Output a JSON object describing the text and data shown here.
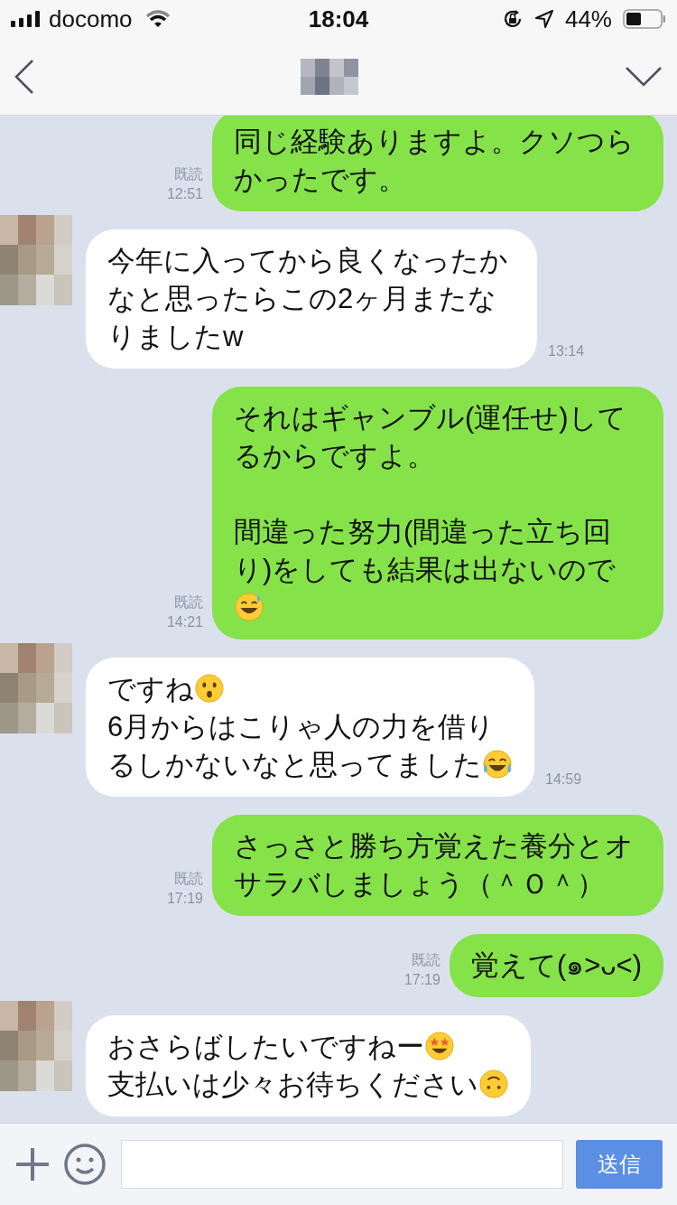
{
  "status_bar": {
    "carrier": "docomo",
    "time": "18:04",
    "battery": "44%"
  },
  "messages": [
    {
      "kind": "sent",
      "read_label": "既読",
      "time": "12:51",
      "paragraphs": [
        {
          "parts": [
            {
              "kind": "text",
              "text": "同じ経験ありますよ。クソつらかったです。"
            }
          ]
        }
      ]
    },
    {
      "kind": "received",
      "time": "13:14",
      "paragraphs": [
        {
          "parts": [
            {
              "kind": "text",
              "text": "今年に入ってから良くなったかなと思ったらこの2ヶ月またなりましたw"
            }
          ]
        }
      ]
    },
    {
      "kind": "sent",
      "read_label": "既読",
      "time": "14:21",
      "paragraphs": [
        {
          "parts": [
            {
              "kind": "text",
              "text": "それはギャンブル(運任せ)してるからですよ。"
            }
          ]
        },
        {
          "blank_line_before": true,
          "parts": [
            {
              "kind": "text",
              "text": "間違った努力(間違った立ち回り)をしても結果は出ないので"
            }
          ]
        },
        {
          "parts": [
            {
              "kind": "sweat"
            }
          ]
        }
      ]
    },
    {
      "kind": "received",
      "time": "14:59",
      "paragraphs": [
        {
          "parts": [
            {
              "kind": "text",
              "text": "ですね"
            },
            {
              "kind": "hushed"
            }
          ]
        },
        {
          "parts": [
            {
              "kind": "text",
              "text": "6月からはこりゃ人の力を借り"
            }
          ]
        },
        {
          "parts": [
            {
              "kind": "text",
              "text": "るしかないなと思ってました"
            },
            {
              "kind": "tears"
            }
          ]
        }
      ]
    },
    {
      "kind": "sent",
      "read_label": "既読",
      "time": "17:19",
      "paragraphs": [
        {
          "parts": [
            {
              "kind": "text",
              "text": "さっさと勝ち方覚えた養分とオサラバしましょう（＾Ｏ＾）"
            }
          ]
        }
      ]
    },
    {
      "kind": "sent",
      "read_label": "既読",
      "time": "17:19",
      "paragraphs": [
        {
          "parts": [
            {
              "kind": "text",
              "text": "覚えて(๑˃ᴗ˂)"
            }
          ]
        }
      ]
    },
    {
      "kind": "received",
      "paragraphs": [
        {
          "parts": [
            {
              "kind": "text",
              "text": "おさらばしたいですねー"
            },
            {
              "kind": "stars"
            }
          ]
        },
        {
          "parts": [
            {
              "kind": "text",
              "text": "支払いは少々お待ちください"
            },
            {
              "kind": "upside"
            }
          ]
        }
      ]
    }
  ],
  "composer": {
    "send": "送信"
  }
}
